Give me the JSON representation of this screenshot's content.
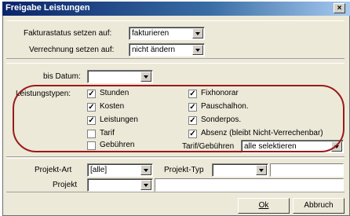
{
  "window": {
    "title": "Freigabe Leistungen",
    "close_symbol": "×"
  },
  "billing": {
    "fakturastatus_label": "Fakturastatus setzen auf:",
    "fakturastatus_value": "fakturieren",
    "verrechnung_label": "Verrechnung setzen auf:",
    "verrechnung_value": "nicht ändern"
  },
  "date": {
    "label": "bis Datum:",
    "value": ""
  },
  "services": {
    "label": "Leistungstypen:",
    "left": [
      {
        "label": "Stunden",
        "checked": true
      },
      {
        "label": "Kosten",
        "checked": true
      },
      {
        "label": "Leistungen",
        "checked": true
      },
      {
        "label": "Tarif",
        "checked": false
      },
      {
        "label": "Gebühren",
        "checked": false
      }
    ],
    "right": [
      {
        "label": "Fixhonorar",
        "checked": true
      },
      {
        "label": "Pauschalhon.",
        "checked": true
      },
      {
        "label": "Sonderpos.",
        "checked": true
      },
      {
        "label": "Absenz (bleibt Nicht-Verrechenbar)",
        "checked": true
      }
    ],
    "tarif_label": "Tarif/Gebühren",
    "tarif_value": "alle selektieren"
  },
  "project": {
    "art_label": "Projekt-Art",
    "art_value": "[alle]",
    "typ_label": "Projekt-Typ",
    "typ_value": "",
    "projekt_label": "Projekt",
    "projekt_value": ""
  },
  "buttons": {
    "ok": "Ok",
    "cancel": "Abbruch"
  }
}
